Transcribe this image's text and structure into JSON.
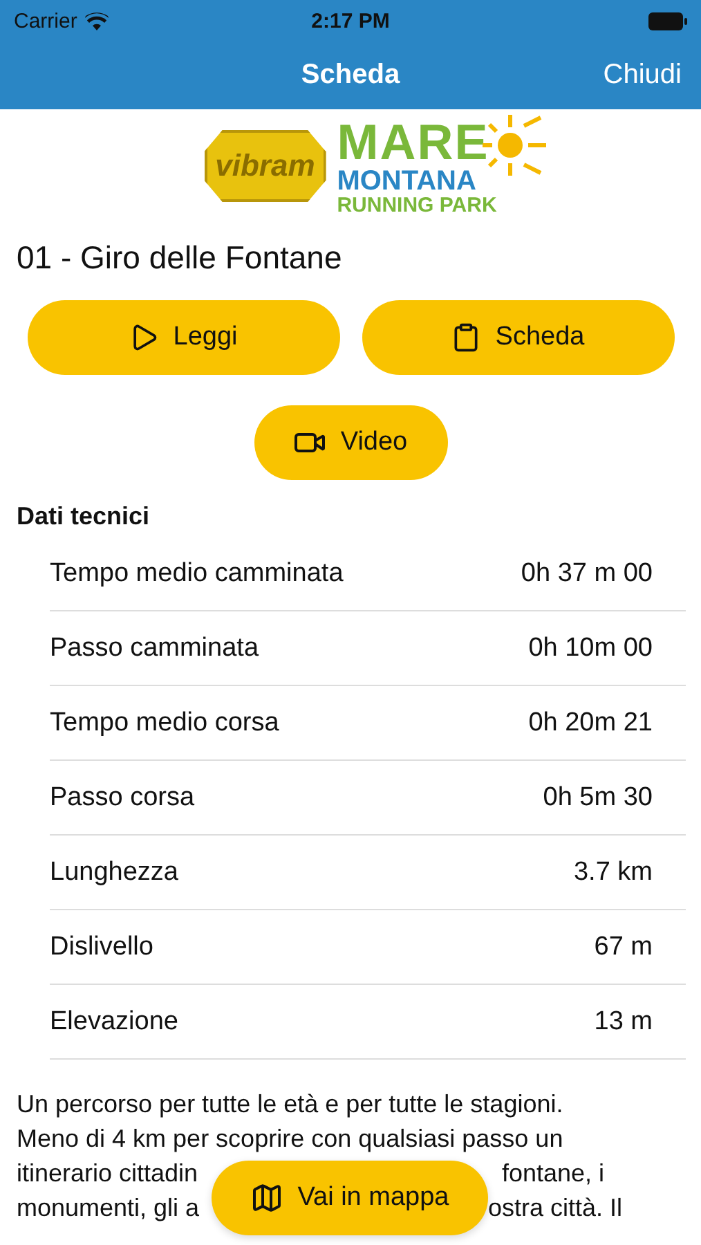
{
  "status_bar": {
    "carrier": "Carrier",
    "time": "2:17 PM"
  },
  "nav": {
    "title": "Scheda",
    "close": "Chiudi"
  },
  "logo": {
    "badge": "vibram",
    "line_1": "MARE",
    "line_2": "MONTANA",
    "line_3": "RUNNING PARK"
  },
  "title": "01 - Giro delle Fontane",
  "buttons": [
    {
      "label": "Leggi",
      "kind": "play"
    },
    {
      "label": "Scheda",
      "kind": "clipboard"
    },
    {
      "label": "Video",
      "kind": "video"
    }
  ],
  "section": "Dati tecnici",
  "rows": [
    {
      "label": "Tempo medio camminata",
      "value": "0h 37 m 00"
    },
    {
      "label": "Passo camminata",
      "value": "0h 10m 00"
    },
    {
      "label": "Tempo medio corsa",
      "value": "0h 20m 21"
    },
    {
      "label": "Passo corsa",
      "value": "0h 5m 30"
    },
    {
      "label": "Lunghezza",
      "value": "3.7 km"
    },
    {
      "label": "Dislivello",
      "value": "67 m"
    },
    {
      "label": "Elevazione",
      "value": "13 m"
    }
  ],
  "description_lines": [
    [
      "Un percorso per tutte le età e per tutte le stagioni."
    ],
    [
      "Meno di 4 km per scoprire con qualsiasi passo un"
    ],
    [
      "itinerario cittadin",
      "fontane, i"
    ],
    [
      "monumenti, gli a",
      "ostra città. Il"
    ]
  ],
  "map_button": {
    "label": "Vai in mappa"
  }
}
